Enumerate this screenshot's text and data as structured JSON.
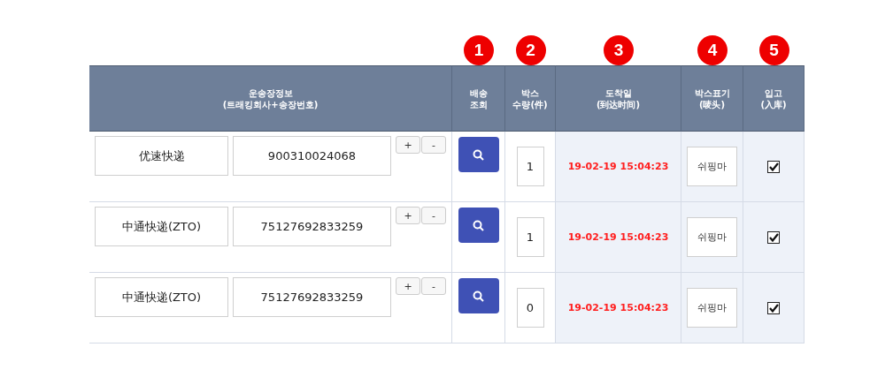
{
  "markers": [
    "1",
    "2",
    "3",
    "4",
    "5"
  ],
  "columns": [
    {
      "lines": [
        "운송장정보",
        "(트래킹회사+송장번호)"
      ]
    },
    {
      "lines": [
        "배송",
        "조회"
      ]
    },
    {
      "lines": [
        "박스",
        "수량(件)"
      ]
    },
    {
      "lines": [
        "도착일",
        "(到达时间)"
      ]
    },
    {
      "lines": [
        "박스표기",
        "(唛头)"
      ]
    },
    {
      "lines": [
        "입고",
        "(入库)"
      ]
    }
  ],
  "rows": [
    {
      "carrier": "优速快递",
      "tracking_no": "900310024068",
      "add": "+",
      "remove": "-",
      "quantity": "1",
      "arrival": "19-02-19 15:04:23",
      "box_mark": "쉬핑마",
      "received": true
    },
    {
      "carrier": "中通快递(ZTO)",
      "tracking_no": "75127692833259",
      "add": "+",
      "remove": "-",
      "quantity": "1",
      "arrival": "19-02-19 15:04:23",
      "box_mark": "쉬핑마",
      "received": true
    },
    {
      "carrier": "中通快递(ZTO)",
      "tracking_no": "75127692833259",
      "add": "+",
      "remove": "-",
      "quantity": "0",
      "arrival": "19-02-19 15:04:23",
      "box_mark": "쉬핑마",
      "received": true
    }
  ]
}
